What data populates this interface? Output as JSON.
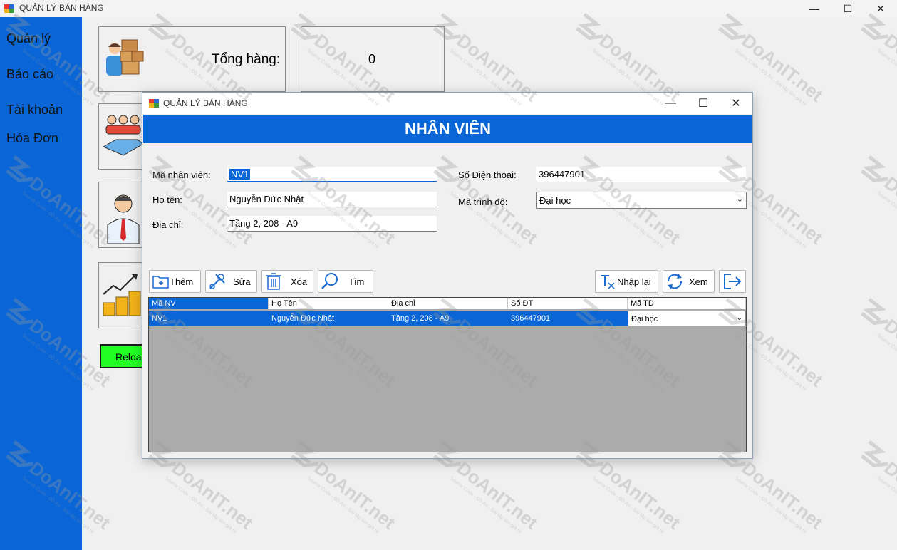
{
  "app": {
    "title": "QUẢN LÝ BÁN HÀNG",
    "window_controls": {
      "minimize": "—",
      "maximize": "☐",
      "close": "✕"
    }
  },
  "sidebar": {
    "items": [
      {
        "label": "Quản lý"
      },
      {
        "label": "Báo cáo"
      },
      {
        "label": "Tài khoản"
      },
      {
        "label": "Hóa Đơn"
      }
    ]
  },
  "dashboard": {
    "total_label": "Tổng hàng:",
    "total_value": "0",
    "reload_label": "Reload"
  },
  "dialog": {
    "title": "QUẢN LÝ BÁN HÀNG",
    "controls": {
      "minimize": "—",
      "maximize": "☐",
      "close": "✕"
    },
    "banner": "NHÂN VIÊN",
    "form": {
      "employee_id_label": "Mã nhân viên:",
      "employee_id_value": "NV1",
      "name_label": "Họ tên:",
      "name_value": "Nguyễn Đức Nhật",
      "address_label": "Địa chỉ:",
      "address_value": "Tầng 2, 208 - A9",
      "phone_label": "Số Điện thoại:",
      "phone_value": "396447901",
      "level_label": "Mã trình độ:",
      "level_value": "Đại học"
    },
    "toolbar": {
      "add": "Thêm",
      "edit": "Sửa",
      "delete": "Xóa",
      "search": "Tìm",
      "reset": "Nhập lại",
      "view": "Xem"
    },
    "grid": {
      "columns": [
        "Mã NV",
        "Họ Tên",
        "Địa chỉ",
        "Số ĐT",
        "Mã TD"
      ],
      "rows": [
        [
          "NV1",
          "Nguyễn Đức Nhật",
          "Tầng 2, 208 - A9",
          "396447901",
          "Đại học"
        ]
      ]
    }
  },
  "watermark": {
    "brand": "DoAnIT.net",
    "tagline": "Source Code - Đồ Án - Bài tập lớn giá rẻ"
  },
  "colors": {
    "accent": "#0a66d6",
    "reload": "#22ff22"
  }
}
